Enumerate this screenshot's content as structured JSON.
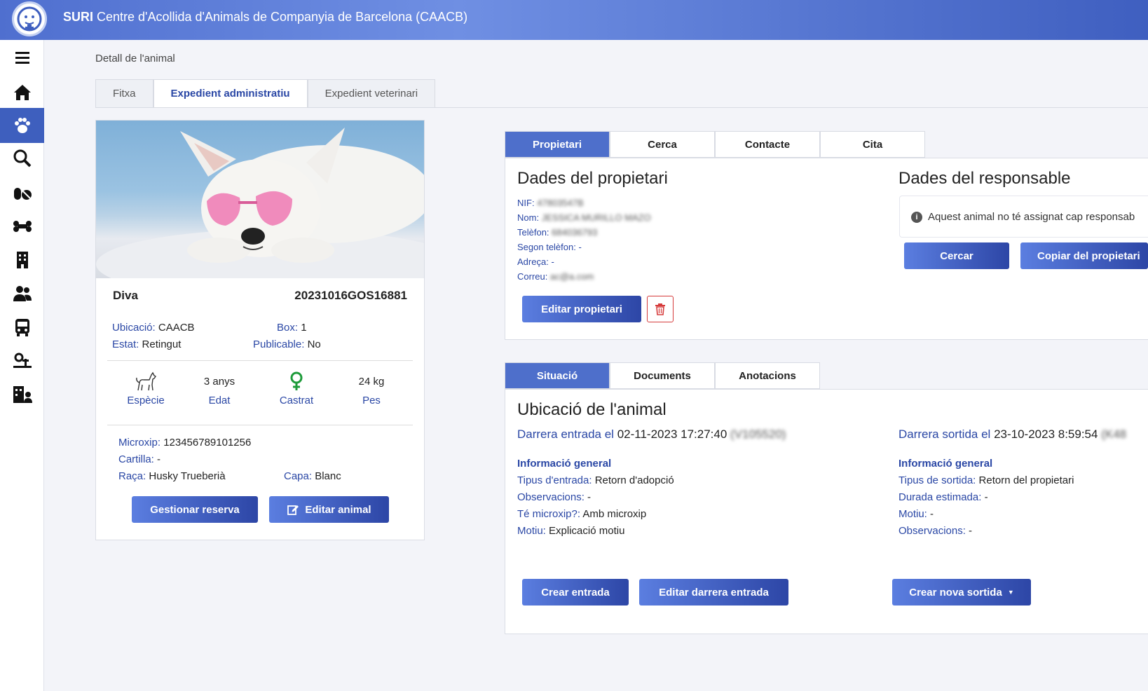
{
  "app": {
    "title_bold": "SURI",
    "title_rest": " Centre d'Acollida d'Animals de Companyia de Barcelona (CAACB)"
  },
  "page": {
    "title": "Detall de l'animal"
  },
  "main_tabs": [
    "Fitxa",
    "Expedient administratiu",
    "Expedient veterinari"
  ],
  "animal": {
    "name": "Diva",
    "code": "20231016GOS16881",
    "ubicacio_label": "Ubicació:",
    "ubicacio": "CAACB",
    "box_label": "Box:",
    "box": "1",
    "estat_label": "Estat:",
    "estat": "Retingut",
    "publicable_label": "Publicable:",
    "publicable": "No",
    "stats": [
      {
        "value": "",
        "label": "Espècie"
      },
      {
        "value": "3 anys",
        "label": "Edat"
      },
      {
        "value": "",
        "label": "Castrat"
      },
      {
        "value": "24 kg",
        "label": "Pes"
      }
    ],
    "microxip_label": "Microxip:",
    "microxip": "123456789101256",
    "cartilla_label": "Cartilla:",
    "cartilla": "-",
    "raca_label": "Raça:",
    "raca": "Husky Trueberià",
    "capa_label": "Capa:",
    "capa": "Blanc",
    "btn_reserva": "Gestionar reserva",
    "btn_editar": "Editar animal"
  },
  "owner_tabs": [
    "Propietari",
    "Cerca",
    "Contacte",
    "Cita"
  ],
  "owner": {
    "title": "Dades del propietari",
    "fields": [
      {
        "label": "NIF:",
        "value": "47803547B",
        "blurred": true
      },
      {
        "label": "Nom:",
        "value": "JESSICA MURILLO MAZO",
        "blurred": true
      },
      {
        "label": "Telèfon:",
        "value": "684036793",
        "blurred": true
      },
      {
        "label": "Segon telèfon:",
        "value": "-",
        "blurred": false
      },
      {
        "label": "Adreça:",
        "value": "-",
        "blurred": false
      },
      {
        "label": "Correu:",
        "value": "ac@a.com",
        "blurred": true
      }
    ],
    "btn_edit": "Editar propietari"
  },
  "responsable": {
    "title": "Dades del responsable",
    "info": "Aquest animal no té assignat cap responsab",
    "btn_cercar": "Cercar",
    "btn_copiar": "Copiar del propietari"
  },
  "situacio_tabs": [
    "Situació",
    "Documents",
    "Anotacions"
  ],
  "situacio": {
    "title": "Ubicació de l'animal",
    "entrada_label": "Darrera entrada el",
    "entrada_date": "02-11-2023 17:27:40",
    "entrada_code": "(V105520)",
    "sortida_label": "Darrera sortida el",
    "sortida_date": "23-10-2023 8:59:54",
    "sortida_code": "(K48",
    "info_title": "Informació general",
    "entrada_fields": [
      {
        "label": "Tipus d'entrada:",
        "value": "Retorn d'adopció"
      },
      {
        "label": "Observacions:",
        "value": "-"
      },
      {
        "label": "Té microxip?:",
        "value": "Amb microxip"
      },
      {
        "label": "Motiu:",
        "value": "Explicació motiu"
      }
    ],
    "sortida_fields": [
      {
        "label": "Tipus de sortida:",
        "value": "Retorn del propietari"
      },
      {
        "label": "Durada estimada:",
        "value": "-"
      },
      {
        "label": "Motiu:",
        "value": "-"
      },
      {
        "label": "Observacions:",
        "value": "-"
      }
    ],
    "btn_crear_entrada": "Crear entrada",
    "btn_editar_entrada": "Editar darrera entrada",
    "btn_nova_sortida": "Crear nova sortida"
  }
}
